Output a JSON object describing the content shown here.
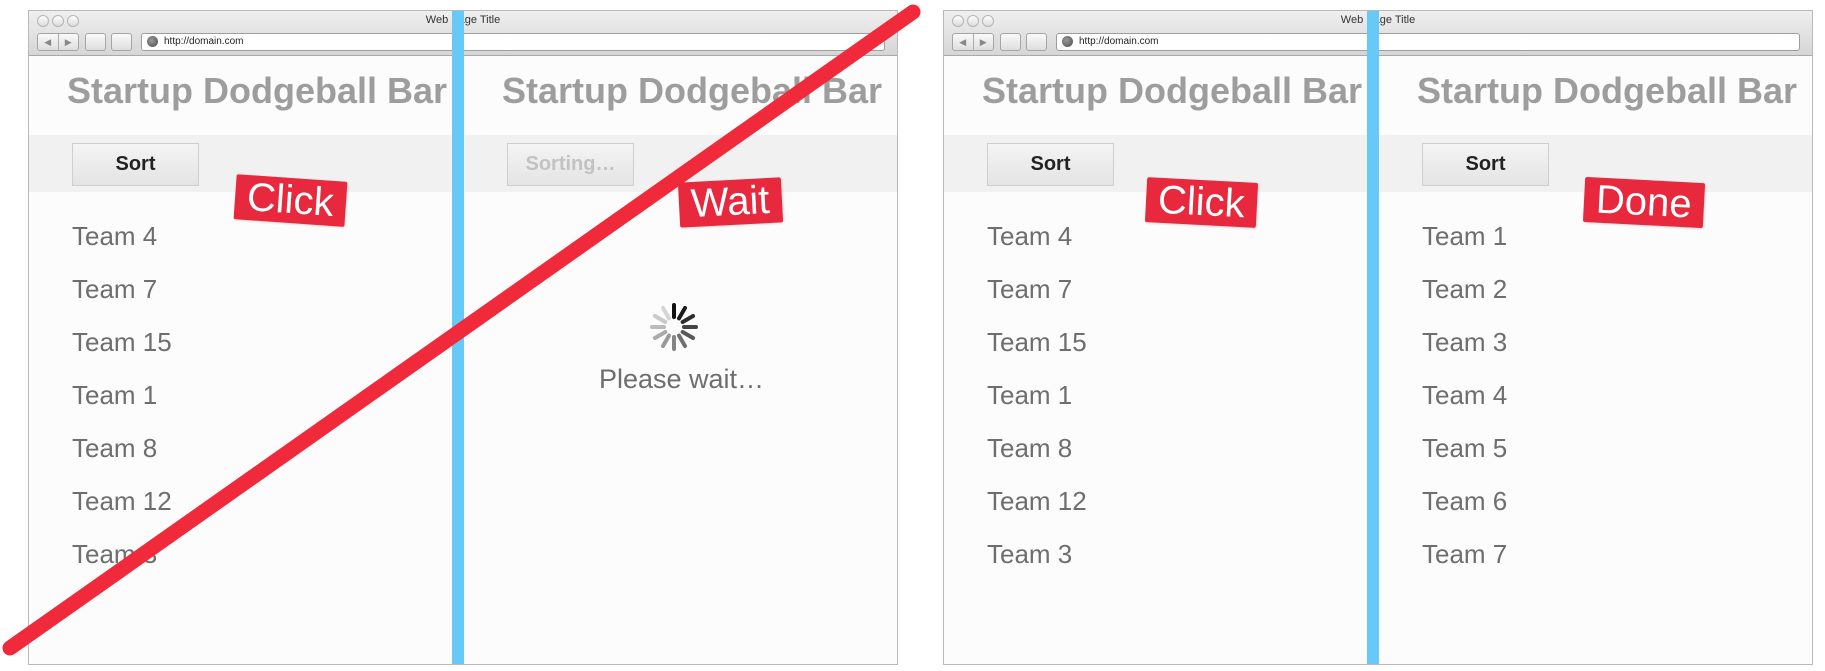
{
  "left_window": {
    "title": "Web Page Title",
    "url": "http://domain.com",
    "app_title": "Startup Dodgeball Bar",
    "before": {
      "sort_label": "Sort",
      "teams": [
        "Team 4",
        "Team 7",
        "Team 15",
        "Team 1",
        "Team 8",
        "Team 12",
        "Team 3"
      ]
    },
    "after": {
      "sort_label": "Sorting…",
      "wait_text": "Please wait…"
    },
    "stamps": {
      "first": "Click",
      "second": "Wait"
    }
  },
  "right_window": {
    "title": "Web Page Title",
    "url": "http://domain.com",
    "app_title": "Startup Dodgeball Bar",
    "before": {
      "sort_label": "Sort",
      "teams": [
        "Team 4",
        "Team 7",
        "Team 15",
        "Team 1",
        "Team 8",
        "Team 12",
        "Team 3"
      ]
    },
    "after": {
      "sort_label": "Sort",
      "teams": [
        "Team 1",
        "Team 2",
        "Team 3",
        "Team 4",
        "Team 5",
        "Team 6",
        "Team 7"
      ]
    },
    "stamps": {
      "first": "Click",
      "second": "Done"
    }
  },
  "colors": {
    "divider": "#67c9f7",
    "stamp": "#e8283c",
    "strike": "#f0293b",
    "title_text": "#9d9d9d"
  },
  "icons": {
    "spinner": "loading-spinner-icon",
    "globe": "globe-icon",
    "back": "back-arrow-icon",
    "forward": "forward-arrow-icon"
  }
}
